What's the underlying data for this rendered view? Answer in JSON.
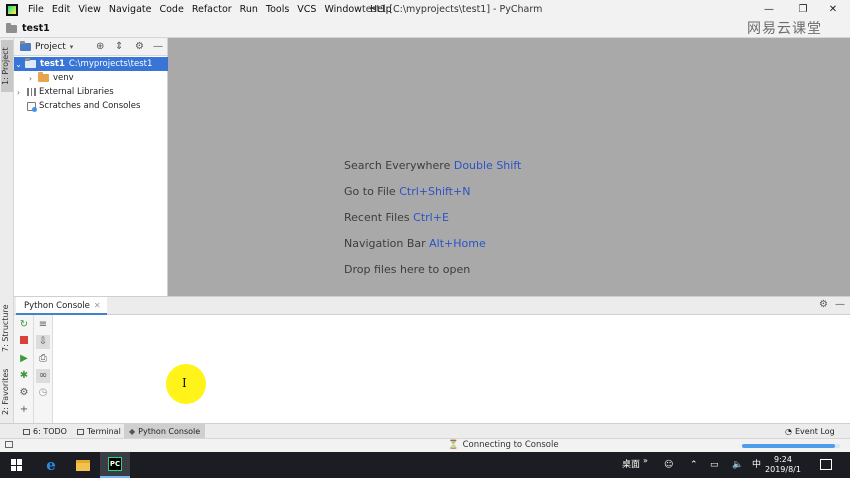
{
  "titlebar": {
    "menu": [
      "File",
      "Edit",
      "View",
      "Navigate",
      "Code",
      "Refactor",
      "Run",
      "Tools",
      "VCS",
      "Window",
      "Help"
    ],
    "title": "test1 [C:\\myprojects\\test1] - PyCharm",
    "controls": {
      "minimize": "—",
      "restore": "❐",
      "close": "✕"
    }
  },
  "navbar": {
    "project": "test1",
    "watermark": "网易云课堂"
  },
  "left_stripe": {
    "project_tab": "1: Project",
    "structure_tab": "7: Structure",
    "favorites_tab": "2: Favorites"
  },
  "project_panel": {
    "title": "Project",
    "tree": [
      {
        "name": "test1",
        "path": "C:\\myprojects\\test1"
      },
      {
        "name": "venv"
      },
      {
        "name": "External Libraries"
      },
      {
        "name": "Scratches and Consoles"
      }
    ]
  },
  "editor": {
    "hints": [
      {
        "text": "Search Everywhere",
        "key": "Double Shift"
      },
      {
        "text": "Go to File",
        "key": "Ctrl+Shift+N"
      },
      {
        "text": "Recent Files",
        "key": "Ctrl+E"
      },
      {
        "text": "Navigation Bar",
        "key": "Alt+Home"
      },
      {
        "text": "Drop files here to open",
        "key": ""
      }
    ]
  },
  "console": {
    "tab_label": "Python Console"
  },
  "bottom_tabs": {
    "todo": "6: TODO",
    "terminal": "Terminal",
    "python_console": "Python Console",
    "event_log": "Event Log"
  },
  "statusbar": {
    "text": "Connecting to Console",
    "progress": 0.95
  },
  "taskbar": {
    "tray_desktop": "桌面",
    "tray_ime": "中",
    "time": "9:24",
    "date": "2019/8/1"
  },
  "colors": {
    "selection": "#3875d7",
    "shortcut": "#2b53c8",
    "editor_bg": "#a9a9a9"
  }
}
